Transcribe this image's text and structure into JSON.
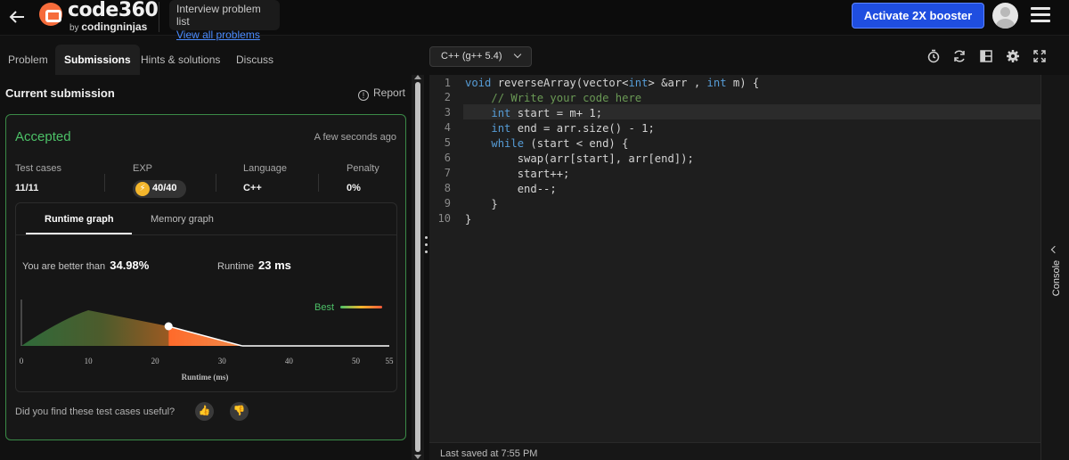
{
  "header": {
    "logo_main": "code360",
    "logo_by": "by",
    "logo_brand": "codingninjas",
    "problem_list_title": "Interview problem list",
    "problem_list_link": "View all problems",
    "booster_label": "Activate 2X booster"
  },
  "left_tabs": [
    "Problem",
    "Submissions",
    "Hints & solutions",
    "Discuss"
  ],
  "submission": {
    "section_title": "Current submission",
    "report_label": "Report",
    "status": "Accepted",
    "time_ago": "A few seconds ago",
    "stats": [
      {
        "label": "Test cases",
        "value": "11/11"
      },
      {
        "label": "EXP",
        "value": "40/40"
      },
      {
        "label": "Language",
        "value": "C++"
      },
      {
        "label": "Penalty",
        "value": "0%"
      }
    ],
    "graph_tabs": [
      "Runtime graph",
      "Memory graph"
    ],
    "better_prefix": "You are better than",
    "better_value": "34.98%",
    "runtime_label": "Runtime",
    "runtime_value": "23 ms",
    "useful_question": "Did you find these test cases useful?"
  },
  "chart_data": {
    "type": "area",
    "xlabel": "Runtime (ms)",
    "x_ticks": [
      0,
      10,
      20,
      30,
      40,
      50,
      55
    ],
    "xlim": [
      0,
      55
    ],
    "legend": "Best",
    "marker_x": 22,
    "curve": [
      [
        0,
        0
      ],
      [
        10,
        1.0
      ],
      [
        22,
        0.55
      ],
      [
        33,
        0
      ],
      [
        55,
        0
      ]
    ]
  },
  "editor": {
    "language": "C++ (g++ 5.4)",
    "lines": [
      "void reverseArray(vector<int> &arr , int m) {",
      "    // Write your code here",
      "    int start = m+ 1;",
      "    int end = arr.size() - 1;",
      "    while (start < end) {",
      "        swap(arr[start], arr[end]);",
      "        start++;",
      "        end--;",
      "    }",
      "}"
    ],
    "line_numbers": [
      "1",
      "2",
      "3",
      "4",
      "5",
      "6",
      "7",
      "8",
      "9",
      "10"
    ],
    "last_saved": "Last saved at 7:55 PM"
  },
  "console_label": "Console",
  "colors": {
    "accent": "#1f4ee0",
    "accepted": "#4cc067",
    "keyword": "#569cd6",
    "comment": "#6a9955"
  }
}
